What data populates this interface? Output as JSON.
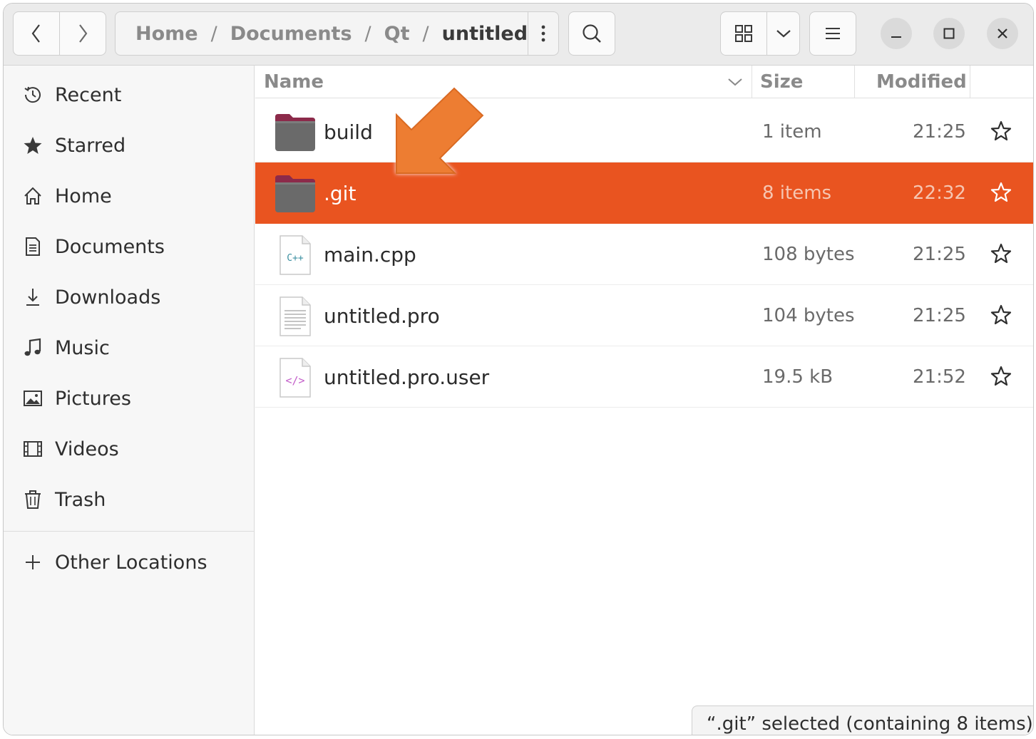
{
  "header": {
    "breadcrumbs": [
      "Home",
      "Documents",
      "Qt"
    ],
    "current_folder": "untitled",
    "separator": "/"
  },
  "sidebar": {
    "items": [
      {
        "label": "Recent",
        "icon": "clock-icon"
      },
      {
        "label": "Starred",
        "icon": "star-icon"
      },
      {
        "label": "Home",
        "icon": "home-icon"
      },
      {
        "label": "Documents",
        "icon": "document-icon"
      },
      {
        "label": "Downloads",
        "icon": "download-icon"
      },
      {
        "label": "Music",
        "icon": "music-icon"
      },
      {
        "label": "Pictures",
        "icon": "picture-icon"
      },
      {
        "label": "Videos",
        "icon": "video-icon"
      },
      {
        "label": "Trash",
        "icon": "trash-icon"
      }
    ],
    "other_locations": {
      "label": "Other Locations",
      "icon": "plus-icon"
    }
  },
  "columns": {
    "name": "Name",
    "size": "Size",
    "modified": "Modified"
  },
  "files": [
    {
      "name": "build",
      "size": "1 item",
      "modified": "21:25",
      "type": "folder",
      "selected": false
    },
    {
      "name": ".git",
      "size": "8 items",
      "modified": "22:32",
      "type": "folder",
      "selected": true
    },
    {
      "name": "main.cpp",
      "size": "108 bytes",
      "modified": "21:25",
      "type": "cpp-file",
      "selected": false
    },
    {
      "name": "untitled.pro",
      "size": "104 bytes",
      "modified": "21:25",
      "type": "text-file",
      "selected": false
    },
    {
      "name": "untitled.pro.user",
      "size": "19.5 kB",
      "modified": "21:52",
      "type": "xml-file",
      "selected": false
    }
  ],
  "status": "“.git” selected  (containing 8 items)",
  "colors": {
    "accent": "#e95420",
    "annotation_arrow": "#ed7d31",
    "folder_tab": "#8c2a4a",
    "folder_body": "#6a6a6a"
  }
}
